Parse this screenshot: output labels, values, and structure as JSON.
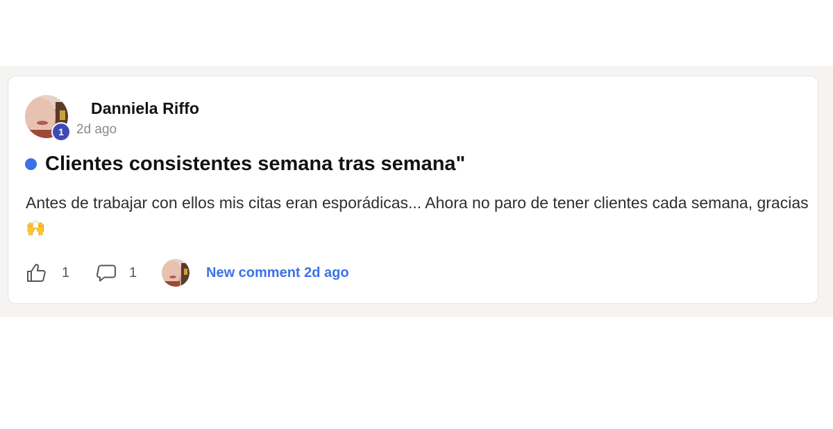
{
  "post": {
    "author": "Danniela Riffo",
    "time": "2d ago",
    "level": "1",
    "title": "Clientes consistentes semana tras semana\"",
    "body": "Antes de trabajar con ellos mis citas eran esporádicas... Ahora no paro de tener clientes cada semana, gracias",
    "body_emoji": "🙌"
  },
  "footer": {
    "likes": "1",
    "comments": "1",
    "new_comment_label": "New comment 2d ago"
  },
  "colors": {
    "accent": "#3a72e8",
    "badge": "#4049b8",
    "band": "#f5f4f2"
  },
  "icons": {
    "like": "thumbs-up-icon",
    "comment": "speech-bubble-icon",
    "unread": "unread-dot"
  }
}
